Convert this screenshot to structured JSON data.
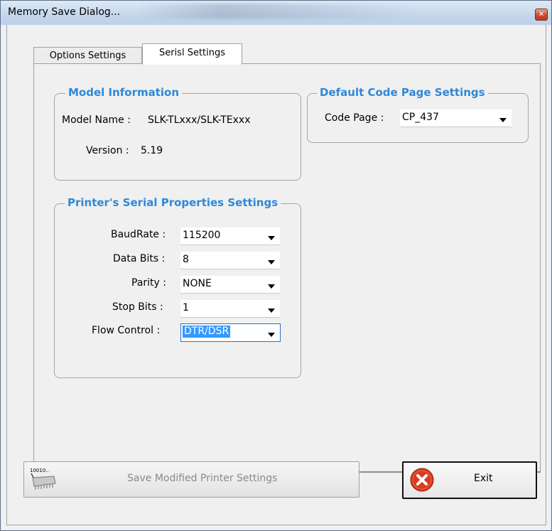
{
  "window": {
    "title": "Memory Save Dialog..."
  },
  "tabs": [
    {
      "label": "Options Settings",
      "active": false
    },
    {
      "label": "Serisl Settings",
      "active": true
    }
  ],
  "model_info": {
    "title": "Model Information",
    "model_name_label": "Model Name :",
    "model_name_value": "SLK-TLxxx/SLK-TExxx",
    "version_label": "Version :",
    "version_value": "5.19"
  },
  "code_page": {
    "title": "Default Code Page Settings",
    "label": "Code Page :",
    "value": "CP_437"
  },
  "serial": {
    "title": "Printer's Serial Properties Settings",
    "baud_label": "BaudRate :",
    "baud_value": "115200",
    "databits_label": "Data Bits :",
    "databits_value": "8",
    "parity_label": "Parity :",
    "parity_value": "NONE",
    "stopbits_label": "Stop Bits :",
    "stopbits_value": "1",
    "flow_label": "Flow Control :",
    "flow_value": "DTR/DSR"
  },
  "buttons": {
    "save_label": "Save Modified Printer Settings",
    "save_icon_text": "10010..",
    "exit_label": "Exit"
  },
  "colors": {
    "group_title": "#2f88d8",
    "selection": "#3399ff",
    "exit_icon": "#d93b1f"
  }
}
